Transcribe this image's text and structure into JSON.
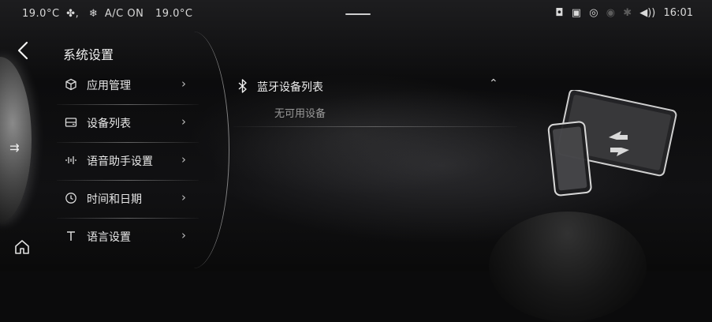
{
  "status_bar": {
    "temp_left": "19.0°C",
    "fan_icon": "fan-icon",
    "ac_label": "A/C ON",
    "temp_right": "19.0°C",
    "time": "16:01",
    "icons": [
      "camera-icon",
      "phone-projection-icon",
      "wifi-hotspot-icon",
      "signal-icon",
      "bluetooth-icon",
      "volume-icon"
    ]
  },
  "header": {
    "title": "系统设置",
    "back_icon": "chevron-left-icon"
  },
  "menu": {
    "items": [
      {
        "label": "应用管理",
        "icon": "cube-icon"
      },
      {
        "label": "设备列表",
        "icon": "device-list-icon"
      },
      {
        "label": "语音助手设置",
        "icon": "voice-wave-icon"
      },
      {
        "label": "时间和日期",
        "icon": "clock-icon"
      },
      {
        "label": "语言设置",
        "icon": "text-t-icon"
      }
    ],
    "chevron": "›"
  },
  "bluetooth": {
    "title": "蓝牙设备列表",
    "empty_text": "无可用设备",
    "caret": "⌃"
  },
  "colors": {
    "background": "#0b0b0c",
    "text": "#e8e8e8",
    "muted": "#9a9a9a"
  }
}
